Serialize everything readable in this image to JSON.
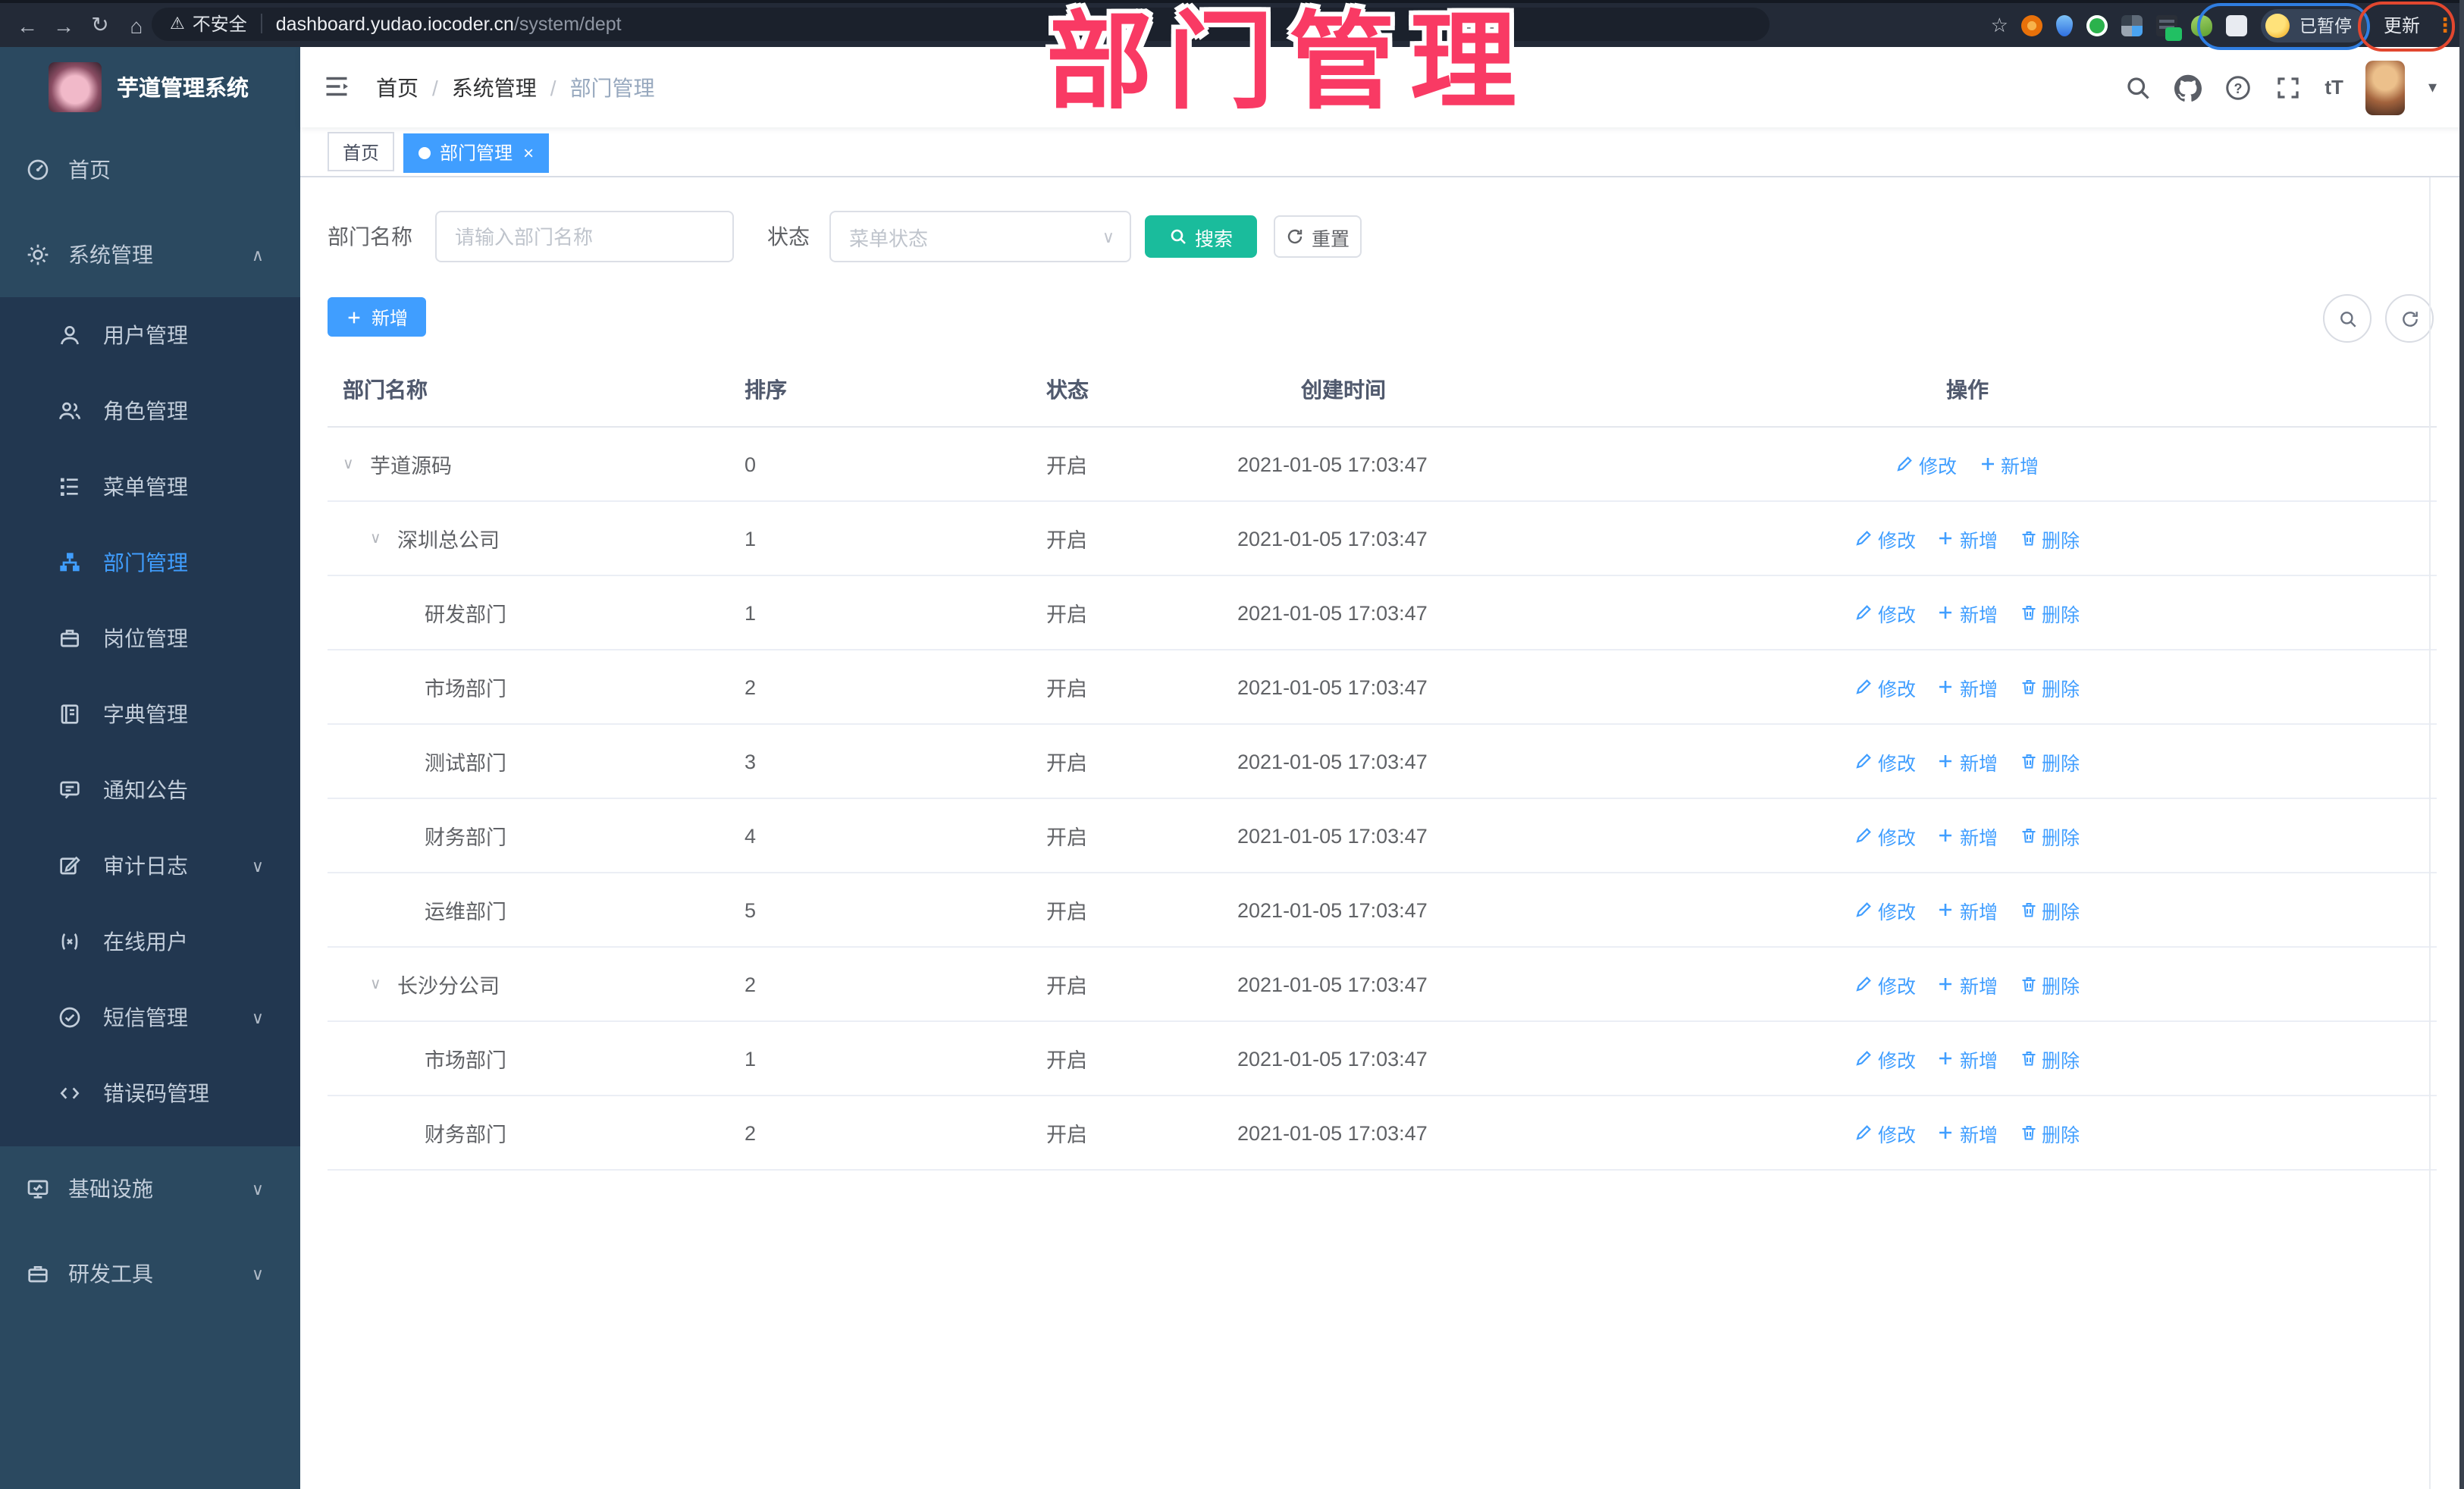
{
  "browser": {
    "security_label": "不安全",
    "url_host": "dashboard.yudao.iocoder.cn",
    "url_path": "/system/dept",
    "profile_status": "已暂停",
    "update_label": "更新",
    "nav_icons": [
      "back",
      "forward",
      "reload",
      "home"
    ],
    "extension_icons": [
      "extension-orange",
      "extension-drop",
      "extension-green-check",
      "extension-grid",
      "extension-list-on",
      "extension-person",
      "extension-puzzle"
    ]
  },
  "annotation": {
    "title": "部门管理",
    "pink": "#F93A64",
    "blue_oval": "#2F7DE0",
    "red_oval": "#E2472F"
  },
  "icons": {
    "back": "←",
    "forward": "→",
    "reload": "↻",
    "home": "⌂",
    "warning": "⚠",
    "star": "☆",
    "more": "⋮",
    "caret_down": "▾",
    "text_size": "tT",
    "expand": "∨",
    "close": "×",
    "select_caret": "∨"
  },
  "sidebar": {
    "brand": "芋道管理系统",
    "active": "部门管理",
    "items": [
      {
        "label": "首页",
        "icon": "gauge"
      },
      {
        "label": "系统管理",
        "icon": "gear",
        "chevron": "up",
        "children": [
          {
            "label": "用户管理",
            "icon": "user"
          },
          {
            "label": "角色管理",
            "icon": "users"
          },
          {
            "label": "菜单管理",
            "icon": "tree"
          },
          {
            "label": "部门管理",
            "icon": "org"
          },
          {
            "label": "岗位管理",
            "icon": "badge"
          },
          {
            "label": "字典管理",
            "icon": "book"
          },
          {
            "label": "通知公告",
            "icon": "notice"
          },
          {
            "label": "审计日志",
            "icon": "editlog",
            "chevron": "down"
          },
          {
            "label": "在线用户",
            "icon": "online"
          },
          {
            "label": "短信管理",
            "icon": "sms",
            "chevron": "down"
          },
          {
            "label": "错误码管理",
            "icon": "code"
          }
        ]
      },
      {
        "label": "基础设施",
        "icon": "monitor",
        "chevron": "down"
      },
      {
        "label": "研发工具",
        "icon": "toolbox",
        "chevron": "down"
      }
    ]
  },
  "header": {
    "breadcrumb": [
      "首页",
      "系统管理",
      "部门管理"
    ],
    "right_icons": [
      "search",
      "github",
      "help",
      "fullscreen",
      "font-size",
      "avatar",
      "caret-down"
    ]
  },
  "tabs": [
    {
      "label": "首页",
      "active": false,
      "closable": false
    },
    {
      "label": "部门管理",
      "active": true,
      "closable": true
    }
  ],
  "filters": {
    "name_label": "部门名称",
    "name_placeholder": "请输入部门名称",
    "name_value": "",
    "status_label": "状态",
    "status_placeholder": "菜单状态",
    "search_label": "搜索",
    "reset_label": "重置"
  },
  "toolbar": {
    "add_label": "新增"
  },
  "table": {
    "columns": [
      "部门名称",
      "排序",
      "状态",
      "创建时间",
      "操作"
    ],
    "rows": [
      {
        "name": "芋道源码",
        "level": 0,
        "expandable": true,
        "sort": "0",
        "status": "开启",
        "created": "2021-01-05 17:03:47",
        "actions": [
          {
            "label": "修改",
            "icon": "pencil"
          },
          {
            "label": "新增",
            "icon": "plus"
          }
        ]
      },
      {
        "name": "深圳总公司",
        "level": 1,
        "expandable": true,
        "sort": "1",
        "status": "开启",
        "created": "2021-01-05 17:03:47",
        "actions": [
          {
            "label": "修改",
            "icon": "pencil"
          },
          {
            "label": "新增",
            "icon": "plus"
          },
          {
            "label": "删除",
            "icon": "trash"
          }
        ]
      },
      {
        "name": "研发部门",
        "level": 2,
        "expandable": false,
        "sort": "1",
        "status": "开启",
        "created": "2021-01-05 17:03:47",
        "actions": [
          {
            "label": "修改",
            "icon": "pencil"
          },
          {
            "label": "新增",
            "icon": "plus"
          },
          {
            "label": "删除",
            "icon": "trash"
          }
        ]
      },
      {
        "name": "市场部门",
        "level": 2,
        "expandable": false,
        "sort": "2",
        "status": "开启",
        "created": "2021-01-05 17:03:47",
        "actions": [
          {
            "label": "修改",
            "icon": "pencil"
          },
          {
            "label": "新增",
            "icon": "plus"
          },
          {
            "label": "删除",
            "icon": "trash"
          }
        ]
      },
      {
        "name": "测试部门",
        "level": 2,
        "expandable": false,
        "sort": "3",
        "status": "开启",
        "created": "2021-01-05 17:03:47",
        "actions": [
          {
            "label": "修改",
            "icon": "pencil"
          },
          {
            "label": "新增",
            "icon": "plus"
          },
          {
            "label": "删除",
            "icon": "trash"
          }
        ]
      },
      {
        "name": "财务部门",
        "level": 2,
        "expandable": false,
        "sort": "4",
        "status": "开启",
        "created": "2021-01-05 17:03:47",
        "actions": [
          {
            "label": "修改",
            "icon": "pencil"
          },
          {
            "label": "新增",
            "icon": "plus"
          },
          {
            "label": "删除",
            "icon": "trash"
          }
        ]
      },
      {
        "name": "运维部门",
        "level": 2,
        "expandable": false,
        "sort": "5",
        "status": "开启",
        "created": "2021-01-05 17:03:47",
        "actions": [
          {
            "label": "修改",
            "icon": "pencil"
          },
          {
            "label": "新增",
            "icon": "plus"
          },
          {
            "label": "删除",
            "icon": "trash"
          }
        ]
      },
      {
        "name": "长沙分公司",
        "level": 1,
        "expandable": true,
        "sort": "2",
        "status": "开启",
        "created": "2021-01-05 17:03:47",
        "actions": [
          {
            "label": "修改",
            "icon": "pencil"
          },
          {
            "label": "新增",
            "icon": "plus"
          },
          {
            "label": "删除",
            "icon": "trash"
          }
        ]
      },
      {
        "name": "市场部门",
        "level": 2,
        "expandable": false,
        "sort": "1",
        "status": "开启",
        "created": "2021-01-05 17:03:47",
        "actions": [
          {
            "label": "修改",
            "icon": "pencil"
          },
          {
            "label": "新增",
            "icon": "plus"
          },
          {
            "label": "删除",
            "icon": "trash"
          }
        ]
      },
      {
        "name": "财务部门",
        "level": 2,
        "expandable": false,
        "sort": "2",
        "status": "开启",
        "created": "2021-01-05 17:03:47",
        "actions": [
          {
            "label": "修改",
            "icon": "pencil"
          },
          {
            "label": "新增",
            "icon": "plus"
          },
          {
            "label": "删除",
            "icon": "trash"
          }
        ]
      }
    ]
  },
  "colors": {
    "accent": "#409EFF",
    "search_button": "#1ABC9C",
    "sidebar_bg": "#2B4960",
    "submenu_bg": "#223750",
    "chrome_bg": "#232A37",
    "link": "#409EFF",
    "breadcrumb_last": "#97A8BE"
  }
}
